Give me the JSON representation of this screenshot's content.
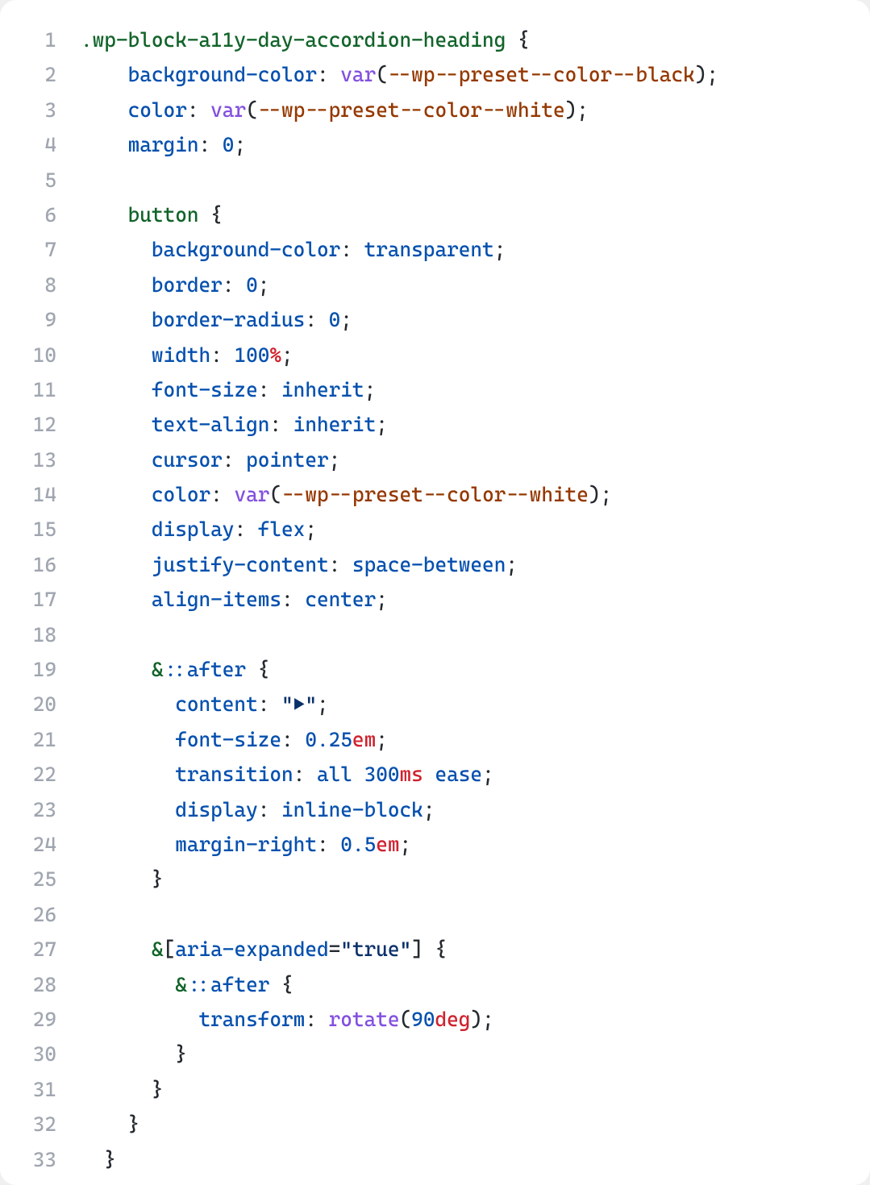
{
  "lines": [
    {
      "n": "1",
      "tokens": [
        [
          "sel",
          ".wp-block-a11y-day-accordion-heading"
        ],
        [
          "punc",
          " {"
        ]
      ]
    },
    {
      "n": "2",
      "tokens": [
        [
          "punc",
          "    "
        ],
        [
          "prop",
          "background-color"
        ],
        [
          "punc",
          ": "
        ],
        [
          "func",
          "var"
        ],
        [
          "punc",
          "("
        ],
        [
          "var",
          "--wp--preset--color--black"
        ],
        [
          "punc",
          ");"
        ]
      ]
    },
    {
      "n": "3",
      "tokens": [
        [
          "punc",
          "    "
        ],
        [
          "prop",
          "color"
        ],
        [
          "punc",
          ": "
        ],
        [
          "func",
          "var"
        ],
        [
          "punc",
          "("
        ],
        [
          "var",
          "--wp--preset--color--white"
        ],
        [
          "punc",
          ");"
        ]
      ]
    },
    {
      "n": "4",
      "tokens": [
        [
          "punc",
          "    "
        ],
        [
          "prop",
          "margin"
        ],
        [
          "punc",
          ": "
        ],
        [
          "num",
          "0"
        ],
        [
          "punc",
          ";"
        ]
      ]
    },
    {
      "n": "5",
      "tokens": []
    },
    {
      "n": "6",
      "tokens": [
        [
          "punc",
          "    "
        ],
        [
          "sel",
          "button"
        ],
        [
          "punc",
          " {"
        ]
      ]
    },
    {
      "n": "7",
      "tokens": [
        [
          "punc",
          "      "
        ],
        [
          "prop",
          "background-color"
        ],
        [
          "punc",
          ": "
        ],
        [
          "kw",
          "transparent"
        ],
        [
          "punc",
          ";"
        ]
      ]
    },
    {
      "n": "8",
      "tokens": [
        [
          "punc",
          "      "
        ],
        [
          "prop",
          "border"
        ],
        [
          "punc",
          ": "
        ],
        [
          "num",
          "0"
        ],
        [
          "punc",
          ";"
        ]
      ]
    },
    {
      "n": "9",
      "tokens": [
        [
          "punc",
          "      "
        ],
        [
          "prop",
          "border-radius"
        ],
        [
          "punc",
          ": "
        ],
        [
          "num",
          "0"
        ],
        [
          "punc",
          ";"
        ]
      ]
    },
    {
      "n": "10",
      "tokens": [
        [
          "punc",
          "      "
        ],
        [
          "prop",
          "width"
        ],
        [
          "punc",
          ": "
        ],
        [
          "num",
          "100"
        ],
        [
          "unit",
          "%"
        ],
        [
          "punc",
          ";"
        ]
      ]
    },
    {
      "n": "11",
      "tokens": [
        [
          "punc",
          "      "
        ],
        [
          "prop",
          "font-size"
        ],
        [
          "punc",
          ": "
        ],
        [
          "kw",
          "inherit"
        ],
        [
          "punc",
          ";"
        ]
      ]
    },
    {
      "n": "12",
      "tokens": [
        [
          "punc",
          "      "
        ],
        [
          "prop",
          "text-align"
        ],
        [
          "punc",
          ": "
        ],
        [
          "kw",
          "inherit"
        ],
        [
          "punc",
          ";"
        ]
      ]
    },
    {
      "n": "13",
      "tokens": [
        [
          "punc",
          "      "
        ],
        [
          "prop",
          "cursor"
        ],
        [
          "punc",
          ": "
        ],
        [
          "kw",
          "pointer"
        ],
        [
          "punc",
          ";"
        ]
      ]
    },
    {
      "n": "14",
      "tokens": [
        [
          "punc",
          "      "
        ],
        [
          "prop",
          "color"
        ],
        [
          "punc",
          ": "
        ],
        [
          "func",
          "var"
        ],
        [
          "punc",
          "("
        ],
        [
          "var",
          "--wp--preset--color--white"
        ],
        [
          "punc",
          ");"
        ]
      ]
    },
    {
      "n": "15",
      "tokens": [
        [
          "punc",
          "      "
        ],
        [
          "prop",
          "display"
        ],
        [
          "punc",
          ": "
        ],
        [
          "kw",
          "flex"
        ],
        [
          "punc",
          ";"
        ]
      ]
    },
    {
      "n": "16",
      "tokens": [
        [
          "punc",
          "      "
        ],
        [
          "prop",
          "justify-content"
        ],
        [
          "punc",
          ": "
        ],
        [
          "kw",
          "space-between"
        ],
        [
          "punc",
          ";"
        ]
      ]
    },
    {
      "n": "17",
      "tokens": [
        [
          "punc",
          "      "
        ],
        [
          "prop",
          "align-items"
        ],
        [
          "punc",
          ": "
        ],
        [
          "kw",
          "center"
        ],
        [
          "punc",
          ";"
        ]
      ]
    },
    {
      "n": "18",
      "tokens": []
    },
    {
      "n": "19",
      "tokens": [
        [
          "punc",
          "      "
        ],
        [
          "amp",
          "&"
        ],
        [
          "pseudo",
          "::after"
        ],
        [
          "punc",
          " {"
        ]
      ]
    },
    {
      "n": "20",
      "tokens": [
        [
          "punc",
          "        "
        ],
        [
          "prop",
          "content"
        ],
        [
          "punc",
          ": "
        ],
        [
          "str",
          "\"▶\""
        ],
        [
          "punc",
          ";"
        ]
      ]
    },
    {
      "n": "21",
      "tokens": [
        [
          "punc",
          "        "
        ],
        [
          "prop",
          "font-size"
        ],
        [
          "punc",
          ": "
        ],
        [
          "num",
          "0.25"
        ],
        [
          "unit",
          "em"
        ],
        [
          "punc",
          ";"
        ]
      ]
    },
    {
      "n": "22",
      "tokens": [
        [
          "punc",
          "        "
        ],
        [
          "prop",
          "transition"
        ],
        [
          "punc",
          ": "
        ],
        [
          "kw",
          "all"
        ],
        [
          "punc",
          " "
        ],
        [
          "num",
          "300"
        ],
        [
          "unit",
          "ms"
        ],
        [
          "punc",
          " "
        ],
        [
          "kw",
          "ease"
        ],
        [
          "punc",
          ";"
        ]
      ]
    },
    {
      "n": "23",
      "tokens": [
        [
          "punc",
          "        "
        ],
        [
          "prop",
          "display"
        ],
        [
          "punc",
          ": "
        ],
        [
          "kw",
          "inline-block"
        ],
        [
          "punc",
          ";"
        ]
      ]
    },
    {
      "n": "24",
      "tokens": [
        [
          "punc",
          "        "
        ],
        [
          "prop",
          "margin-right"
        ],
        [
          "punc",
          ": "
        ],
        [
          "num",
          "0.5"
        ],
        [
          "unit",
          "em"
        ],
        [
          "punc",
          ";"
        ]
      ]
    },
    {
      "n": "25",
      "tokens": [
        [
          "punc",
          "      }"
        ]
      ]
    },
    {
      "n": "26",
      "tokens": []
    },
    {
      "n": "27",
      "tokens": [
        [
          "punc",
          "      "
        ],
        [
          "amp",
          "&"
        ],
        [
          "punc",
          "["
        ],
        [
          "attr",
          "aria-expanded"
        ],
        [
          "punc",
          "="
        ],
        [
          "str",
          "\"true\""
        ],
        [
          "punc",
          "] {"
        ]
      ]
    },
    {
      "n": "28",
      "tokens": [
        [
          "punc",
          "        "
        ],
        [
          "amp",
          "&"
        ],
        [
          "pseudo",
          "::after"
        ],
        [
          "punc",
          " {"
        ]
      ]
    },
    {
      "n": "29",
      "tokens": [
        [
          "punc",
          "          "
        ],
        [
          "prop",
          "transform"
        ],
        [
          "punc",
          ": "
        ],
        [
          "func",
          "rotate"
        ],
        [
          "punc",
          "("
        ],
        [
          "num",
          "90"
        ],
        [
          "unit",
          "deg"
        ],
        [
          "punc",
          ");"
        ]
      ]
    },
    {
      "n": "30",
      "tokens": [
        [
          "punc",
          "        }"
        ]
      ]
    },
    {
      "n": "31",
      "tokens": [
        [
          "punc",
          "      }"
        ]
      ]
    },
    {
      "n": "32",
      "tokens": [
        [
          "punc",
          "    }"
        ]
      ]
    },
    {
      "n": "33",
      "tokens": [
        [
          "punc",
          "  }"
        ]
      ]
    }
  ]
}
